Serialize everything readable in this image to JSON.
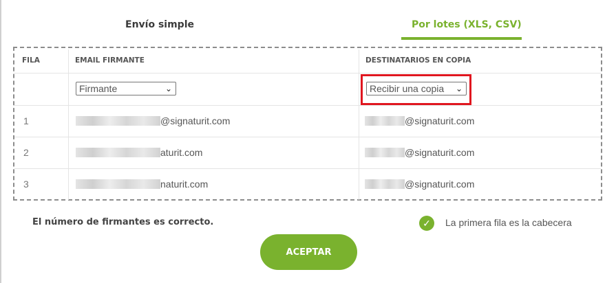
{
  "tabs": {
    "simple": "Envío simple",
    "batch": "Por lotes (XLS, CSV)"
  },
  "table": {
    "headers": {
      "row": "FILA",
      "signer_email": "EMAIL FIRMANTE",
      "cc_recipients": "DESTINATARIOS EN COPIA"
    },
    "selectors": {
      "signer": "Firmante",
      "cc": "Recibir una copia"
    },
    "rows": [
      {
        "num": "1",
        "email": "@signaturit.com",
        "cc": "@signaturit.com"
      },
      {
        "num": "2",
        "email": "aturit.com",
        "cc": "@signaturit.com"
      },
      {
        "num": "3",
        "email": "naturit.com",
        "cc": "@signaturit.com"
      }
    ]
  },
  "status": {
    "message": "El número de firmantes es correcto.",
    "first_row_header_label": "La primera fila es la cabecera"
  },
  "accept_button": "ACEPTAR",
  "colors": {
    "accent": "#7ab22e",
    "highlight": "#e0161f"
  },
  "icons": {
    "checkbox": "check-icon",
    "select_arrow": "chevron-down-icon"
  }
}
